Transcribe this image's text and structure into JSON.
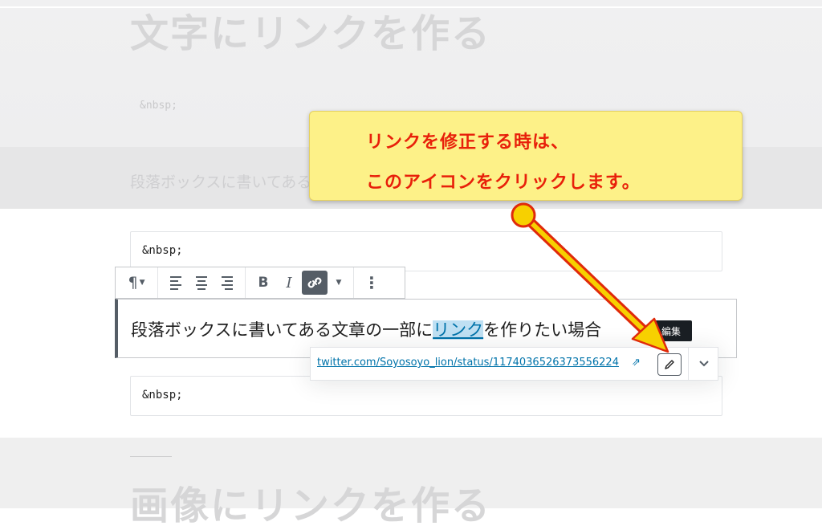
{
  "background": {
    "heading_top": "文字にリンクを作る",
    "nbsp_faded": "&nbsp;",
    "paragraph_faded": "段落ボックスに書いてある",
    "heading_bottom": "画像にリンクを作る"
  },
  "blocks": {
    "nbsp_above": "&nbsp;",
    "nbsp_below": "&nbsp;"
  },
  "toolbar": {
    "paragraph_icon": "¶",
    "bold_label": "B",
    "italic_label": "I",
    "more_icon": "⋮"
  },
  "paragraph": {
    "text_before": "段落ボックスに書いてある文章の一部に",
    "link_text": "リンク",
    "text_after": "を作りたい場合"
  },
  "link_popover": {
    "url": "twitter.com/Soyosoyo_lion/status/1174036526373556224",
    "ext_icon": "⇗"
  },
  "tooltip": {
    "label": "編集"
  },
  "callout": {
    "line1": "リンクを修正する時は、",
    "line2": "このアイコンをクリックします。"
  },
  "colors": {
    "callout_bg": "#fdf188",
    "callout_text": "#e8200a",
    "link": "#0073aa",
    "arrow_fill": "#f7d000",
    "arrow_outline": "#e02a0a"
  },
  "icons": [
    "paragraph-icon",
    "align-left-icon",
    "align-center-icon",
    "align-right-icon",
    "bold-icon",
    "italic-icon",
    "unlink-icon",
    "caret-down-icon",
    "more-vertical-icon",
    "external-link-icon",
    "pencil-icon",
    "chevron-down-icon"
  ]
}
